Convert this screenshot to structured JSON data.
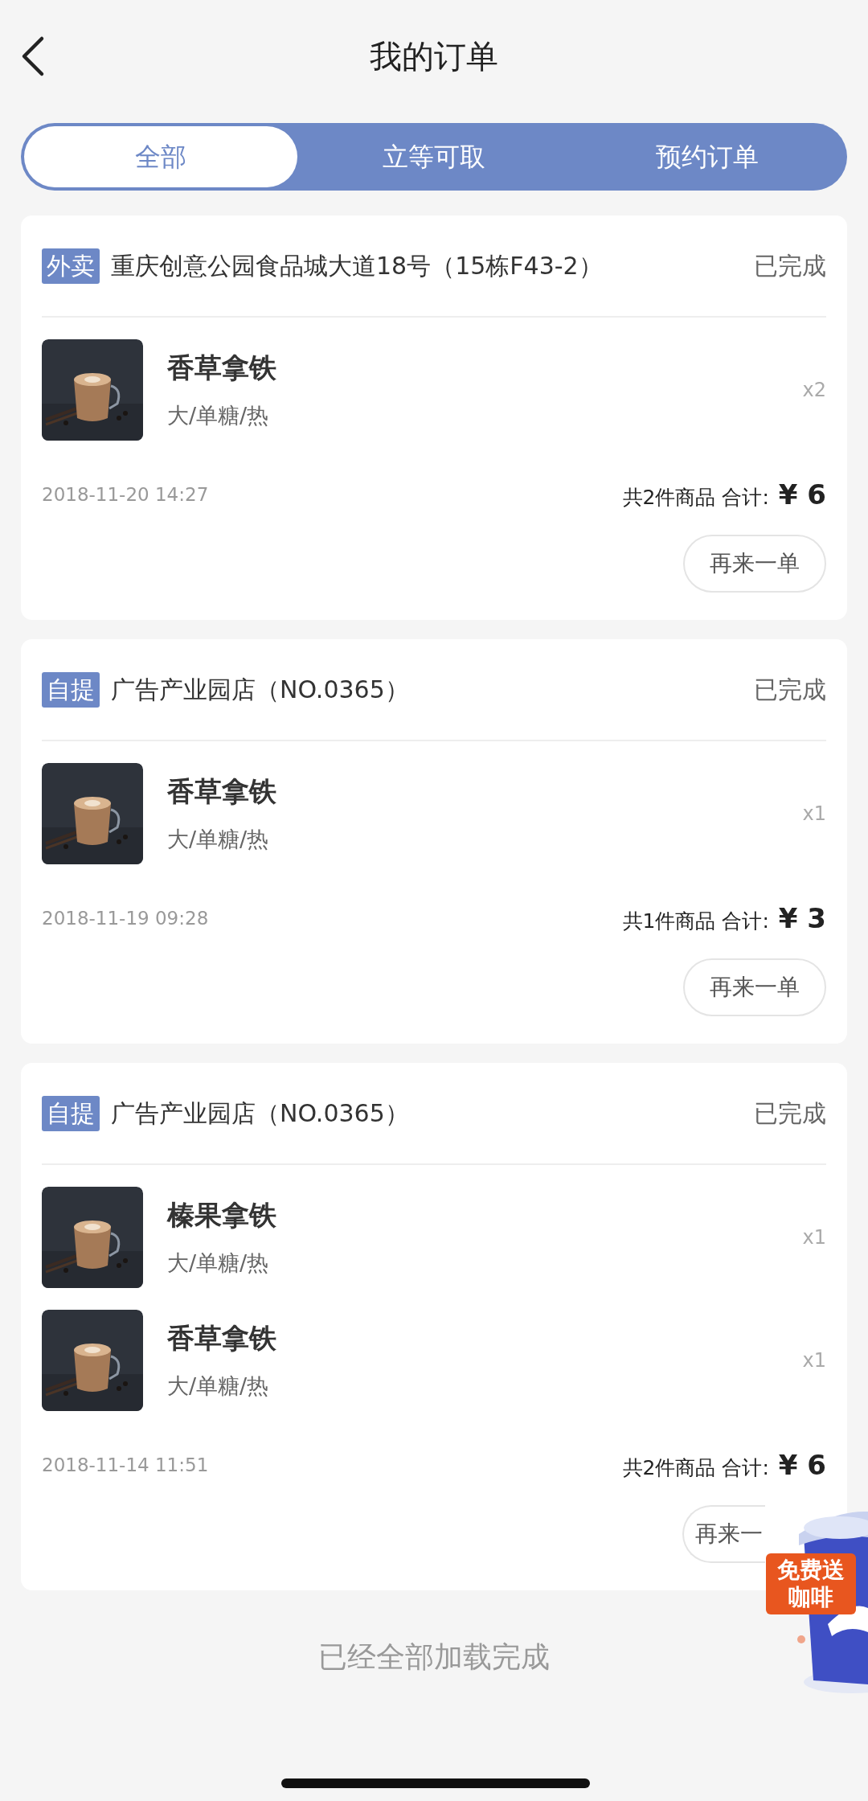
{
  "header": {
    "title": "我的订单"
  },
  "tabs": [
    {
      "label": "全部",
      "selected": true
    },
    {
      "label": "立等可取",
      "selected": false
    },
    {
      "label": "预约订单",
      "selected": false
    }
  ],
  "orders": [
    {
      "type_tag": "外卖",
      "store": "重庆创意公园食品城大道18号（15栋F43-2）",
      "status": "已完成",
      "items": [
        {
          "name": "香草拿铁",
          "options": "大/单糖/热",
          "quantity": "x2"
        }
      ],
      "time": "2018-11-20 14:27",
      "summary": "共2件商品 合计:",
      "price": "¥ 6",
      "button": "再来一单"
    },
    {
      "type_tag": "自提",
      "store": "广告产业园店（NO.0365）",
      "status": "已完成",
      "items": [
        {
          "name": "香草拿铁",
          "options": "大/单糖/热",
          "quantity": "x1"
        }
      ],
      "time": "2018-11-19 09:28",
      "summary": "共1件商品 合计:",
      "price": "¥ 3",
      "button": "再来一单"
    },
    {
      "type_tag": "自提",
      "store": "广告产业园店（NO.0365）",
      "status": "已完成",
      "items": [
        {
          "name": "榛果拿铁",
          "options": "大/单糖/热",
          "quantity": "x1"
        },
        {
          "name": "香草拿铁",
          "options": "大/单糖/热",
          "quantity": "x1"
        }
      ],
      "time": "2018-11-14 11:51",
      "summary": "共2件商品 合计:",
      "price": "¥ 6",
      "button": "再来一"
    }
  ],
  "promo": {
    "badge": "免费送咖啡"
  },
  "footer": "已经全部加载完成"
}
